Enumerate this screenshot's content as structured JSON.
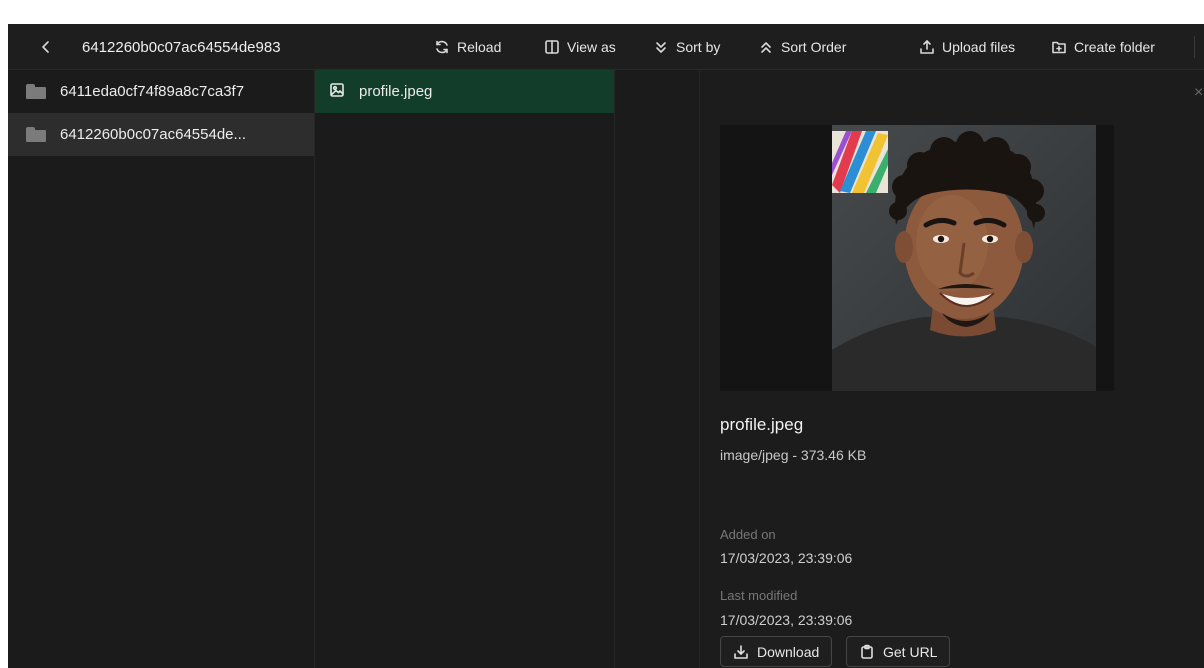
{
  "toolbar": {
    "current_path": "6412260b0c07ac64554de983",
    "reload_label": "Reload",
    "view_as_label": "View as",
    "sort_by_label": "Sort by",
    "sort_order_label": "Sort Order",
    "upload_label": "Upload files",
    "create_folder_label": "Create folder"
  },
  "folders": [
    {
      "name": "6411eda0cf74f89a8c7ca3f7"
    },
    {
      "name": "6412260b0c07ac64554de..."
    }
  ],
  "files": [
    {
      "name": "profile.jpeg"
    }
  ],
  "preview": {
    "close_glyph": "×",
    "file_name": "profile.jpeg",
    "file_meta": "image/jpeg - 373.46 KB",
    "added_label": "Added on",
    "added_value": "17/03/2023, 23:39:06",
    "modified_label": "Last modified",
    "modified_value": "17/03/2023, 23:39:06",
    "download_label": "Download",
    "get_url_label": "Get URL"
  },
  "colors": {
    "selected_file_bg": "#123d2a",
    "selected_folder_bg": "#2d2d2d",
    "app_bg": "#1c1c1c"
  }
}
